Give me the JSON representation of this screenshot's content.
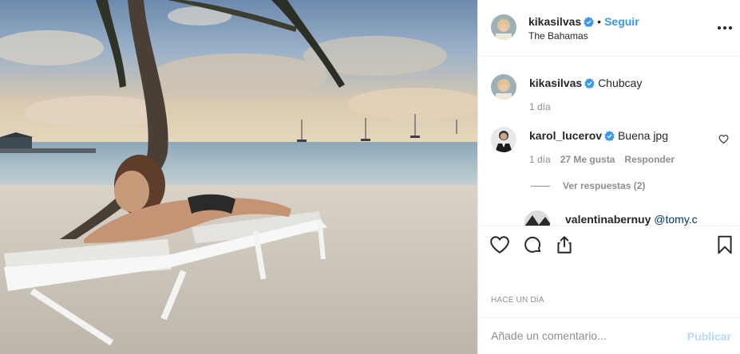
{
  "post": {
    "username": "kikasilvas",
    "separator": "•",
    "follow_label": "Seguir",
    "location": "The Bahamas"
  },
  "comments": [
    {
      "username": "kikasilvas",
      "text": "Chubcay",
      "time": "1 día"
    },
    {
      "username": "karol_lucerov",
      "text": "Buena jpg",
      "time": "1 día",
      "likes": "27 Me gusta",
      "reply_label": "Responder"
    },
    {
      "username": "valentinabernuy",
      "text": "@tomy.c"
    }
  ],
  "view_replies": "Ver respuestas (2)",
  "date_label": "HACE UN DÍA",
  "add_comment": {
    "placeholder": "Añade un comentario...",
    "publish_label": "Publicar"
  },
  "colors": {
    "link_blue": "#3897f0",
    "publish_disabled": "#b3dbff",
    "muted": "#8e8e8e",
    "text": "#262626"
  },
  "icons": [
    "verified-icon",
    "more-options-icon",
    "heart-icon",
    "comment-icon",
    "share-icon",
    "bookmark-icon"
  ]
}
